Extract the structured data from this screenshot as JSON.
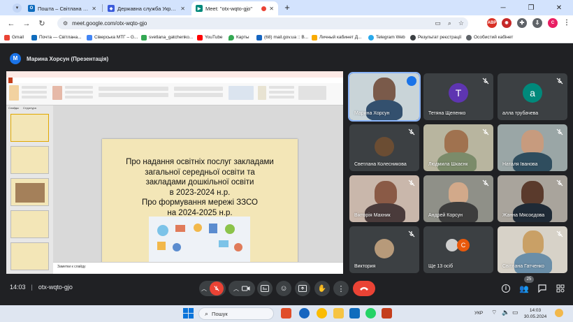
{
  "browser": {
    "tabs": [
      {
        "title": "Пошта – Світлана Гатченко – Ou",
        "favicon": "outlook-icon",
        "color": "#0f6cbd",
        "active": false
      },
      {
        "title": "Державна служба України з пи",
        "favicon": "shield-icon",
        "color": "#3b5bdb",
        "active": false
      },
      {
        "title": "Meet: \"otx-wqto-gjo\"",
        "favicon": "meet-icon",
        "color": "#00897b",
        "active": true
      }
    ],
    "new_tab": "+",
    "address": "meet.google.com/otx-wqto-gjo",
    "bookmarks": [
      {
        "label": "Gmail",
        "color": "#ea4335"
      },
      {
        "label": "Почта — Світлана...",
        "color": "#0f6cbd"
      },
      {
        "label": "Сіверська МТГ – G...",
        "color": "#4285f4"
      },
      {
        "label": "svetlana_gatchenko...",
        "color": "#34a853"
      },
      {
        "label": "YouTube",
        "color": "#ff0000"
      },
      {
        "label": "Карты",
        "color": "#34a853"
      },
      {
        "label": "(68) mail.gov.ua :: B...",
        "color": "#1565c0"
      },
      {
        "label": "Личный кабинет Д...",
        "color": "#f9ab00"
      },
      {
        "label": "Telegram Web",
        "color": "#29a9eb"
      },
      {
        "label": "Результат реєстрації",
        "color": "#3c4043"
      },
      {
        "label": "Особистий кабінет",
        "color": "#5f6368"
      }
    ]
  },
  "meet": {
    "presenter_initial": "M",
    "presenter_label": "Марина Хорсун (Презентація)",
    "meeting_time": "14:03",
    "meeting_code": "otx-wqto-gjo",
    "participants_count": "25",
    "participants": [
      {
        "name": "Марина Хорсун",
        "speaking": true
      },
      {
        "name": "Тетяна Щепенко",
        "initial": "Т",
        "color": "#5e35b1"
      },
      {
        "name": "алла трубачева",
        "initial": "а",
        "color": "#00897b"
      },
      {
        "name": "Светлана Колесникова"
      },
      {
        "name": "Людмила Шкаєнк"
      },
      {
        "name": "Наталя Іванова"
      },
      {
        "name": "Вікторія Махник"
      },
      {
        "name": "Андрей Корсун"
      },
      {
        "name": "Жанна Мясоєдова"
      },
      {
        "name": "Виктория"
      },
      {
        "name": "Ще 13 осіб",
        "initial": "С",
        "color": "#e8590c"
      },
      {
        "name": "Світлана Гатченко"
      }
    ]
  },
  "slide": {
    "lines": [
      "Про надання освітніх послуг закладами",
      "загальної середньої освіти та",
      "закладами дошкільної освіти",
      "в 2023-2024 н.р.",
      "Про формування мережі ЗЗСО",
      "на 2024-2025 н.р."
    ],
    "notes_placeholder": "Заметки к слайду",
    "left_tabs": [
      "Слайды",
      "Структура"
    ],
    "zoom": "38:05"
  },
  "taskbar": {
    "search_placeholder": "Пошук",
    "lang": "УКР",
    "time": "14:03",
    "date": "30.05.2024"
  }
}
